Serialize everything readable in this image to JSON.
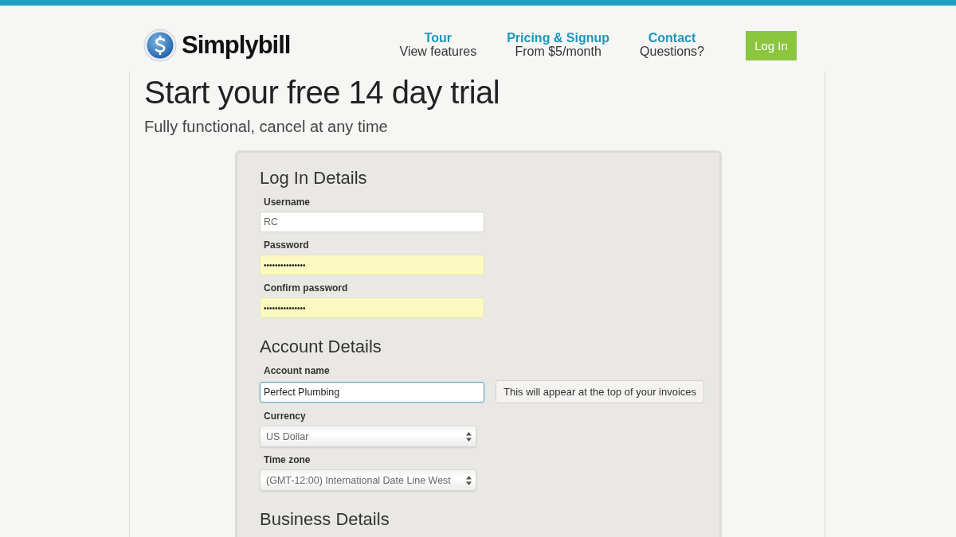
{
  "header": {
    "brand": "Simplybill",
    "nav": [
      {
        "title": "Tour",
        "subtitle": "View features"
      },
      {
        "title": "Pricing & Signup",
        "subtitle": "From $5/month"
      },
      {
        "title": "Contact",
        "subtitle": "Questions?"
      }
    ],
    "login_button": "Log In"
  },
  "page": {
    "title": "Start your free 14 day trial",
    "subtitle": "Fully functional, cancel at any time"
  },
  "sections": [
    {
      "title": "Log In Details",
      "fields": [
        {
          "kind": "text",
          "label": "Username",
          "value": "RC",
          "autofilled": false,
          "focused": false
        },
        {
          "kind": "text",
          "label": "Password",
          "value": "•••••••••••••••",
          "autofilled": true,
          "focused": false
        },
        {
          "kind": "text",
          "label": "Confirm password",
          "value": "•••••••••••••••",
          "autofilled": true,
          "focused": false
        }
      ]
    },
    {
      "title": "Account Details",
      "fields": [
        {
          "kind": "text",
          "label": "Account name",
          "value": "Perfect Plumbing",
          "autofilled": false,
          "focused": true,
          "hint": "This will appear at the top of your invoices"
        },
        {
          "kind": "select",
          "label": "Currency",
          "value": "US Dollar"
        },
        {
          "kind": "select",
          "label": "Time zone",
          "value": "(GMT-12:00) International Date Line West"
        }
      ]
    },
    {
      "title": "Business Details"
    }
  ]
}
